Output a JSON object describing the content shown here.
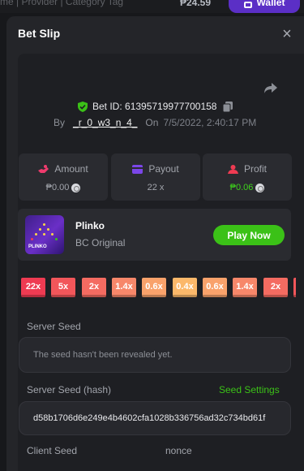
{
  "topbar": {
    "breadcrumb": "me | Provider | Category Tag",
    "balance": "₱24.59",
    "wallet_label": "Wallet"
  },
  "betslip": {
    "title": "Bet Slip",
    "close_icon": "close-icon",
    "share_icon": "share-icon",
    "bet_id_label": "Bet ID: 613957199777001 58",
    "bet_id": "Bet ID: 61395719977700158",
    "by_label": "By",
    "username": "_r_0_w3_n_4_",
    "on_label": "On",
    "datetime": "7/5/2022, 2:40:17 PM"
  },
  "stats": {
    "amount": {
      "label": "Amount",
      "value": "₱0.00",
      "icon": "amount-icon"
    },
    "payout": {
      "label": "Payout",
      "value": "22 x",
      "icon": "payout-icon"
    },
    "profit": {
      "label": "Profit",
      "value": "₱0.06",
      "icon": "profit-icon",
      "color": "#3ed31b"
    }
  },
  "game": {
    "name": "Plinko",
    "provider": "BC Original",
    "thumb_text": "PLINKO",
    "play_label": "Play Now",
    "play_color": "#3bc117"
  },
  "multipliers": [
    {
      "label": "22x",
      "color": "#ef3b52"
    },
    {
      "label": "5x",
      "color": "#f2565a"
    },
    {
      "label": "2x",
      "color": "#f46b61"
    },
    {
      "label": "1.4x",
      "color": "#f7876a"
    },
    {
      "label": "0.6x",
      "color": "#f9a26b"
    },
    {
      "label": "0.4x",
      "color": "#fbb86a"
    },
    {
      "label": "0.6x",
      "color": "#f9a26b"
    },
    {
      "label": "1.4x",
      "color": "#f7876a"
    },
    {
      "label": "2x",
      "color": "#f46b61"
    },
    {
      "label": "",
      "color": "#f2565a"
    }
  ],
  "seeds": {
    "server_seed_label": "Server Seed",
    "server_seed_value": "The seed hasn't been revealed yet.",
    "server_seed_hash_label": "Server Seed (hash)",
    "seed_settings_label": "Seed Settings",
    "server_seed_hash_value": "d58b1706d6e249e4b4602cfa1028b336756ad32c734bd61f",
    "client_seed_label": "Client Seed",
    "nonce_label": "nonce"
  }
}
